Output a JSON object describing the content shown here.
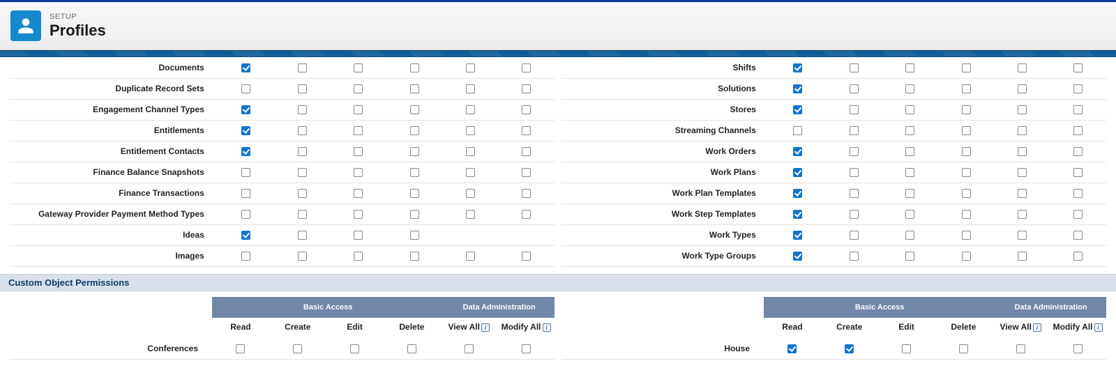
{
  "header": {
    "setup": "SETUP",
    "title": "Profiles"
  },
  "left_rows": [
    {
      "label": "Documents",
      "cells": [
        true,
        false,
        false,
        false,
        false,
        false
      ]
    },
    {
      "label": "Duplicate Record Sets",
      "cells": [
        false,
        false,
        false,
        false,
        false,
        false
      ]
    },
    {
      "label": "Engagement Channel Types",
      "cells": [
        true,
        false,
        false,
        false,
        false,
        false
      ]
    },
    {
      "label": "Entitlements",
      "cells": [
        true,
        false,
        false,
        false,
        false,
        false
      ]
    },
    {
      "label": "Entitlement Contacts",
      "cells": [
        true,
        false,
        false,
        false,
        false,
        false
      ]
    },
    {
      "label": "Finance Balance Snapshots",
      "cells": [
        false,
        false,
        false,
        false,
        false,
        false
      ]
    },
    {
      "label": "Finance Transactions",
      "cells": [
        false,
        false,
        false,
        false,
        false,
        false
      ]
    },
    {
      "label": "Gateway Provider Payment Method Types",
      "cells": [
        false,
        false,
        false,
        false,
        false,
        false
      ]
    },
    {
      "label": "Ideas",
      "cells": [
        true,
        false,
        false,
        false,
        null,
        null
      ]
    },
    {
      "label": "Images",
      "cells": [
        false,
        false,
        false,
        false,
        false,
        false
      ]
    }
  ],
  "right_rows": [
    {
      "label": "Shifts",
      "cells": [
        true,
        false,
        false,
        false,
        false,
        false
      ]
    },
    {
      "label": "Solutions",
      "cells": [
        true,
        false,
        false,
        false,
        false,
        false
      ]
    },
    {
      "label": "Stores",
      "cells": [
        true,
        false,
        false,
        false,
        false,
        false
      ]
    },
    {
      "label": "Streaming Channels",
      "cells": [
        false,
        false,
        false,
        false,
        false,
        false
      ]
    },
    {
      "label": "Work Orders",
      "cells": [
        true,
        false,
        false,
        false,
        false,
        false
      ]
    },
    {
      "label": "Work Plans",
      "cells": [
        true,
        false,
        false,
        false,
        false,
        false
      ]
    },
    {
      "label": "Work Plan Templates",
      "cells": [
        true,
        false,
        false,
        false,
        false,
        false
      ]
    },
    {
      "label": "Work Step Templates",
      "cells": [
        true,
        false,
        false,
        false,
        false,
        false
      ]
    },
    {
      "label": "Work Types",
      "cells": [
        true,
        false,
        false,
        false,
        false,
        false
      ]
    },
    {
      "label": "Work Type Groups",
      "cells": [
        true,
        false,
        false,
        false,
        false,
        false
      ]
    }
  ],
  "section_custom_title": "Custom Object Permissions",
  "group_headers": {
    "basic_access": "Basic Access",
    "data_admin": "Data Administration"
  },
  "columns": {
    "read": "Read",
    "create": "Create",
    "edit": "Edit",
    "delete": "Delete",
    "view_all": "View All",
    "modify_all": "Modify All"
  },
  "custom_left_rows": [
    {
      "label": "Conferences",
      "cells": [
        false,
        false,
        false,
        false,
        false,
        false
      ]
    }
  ],
  "custom_right_rows": [
    {
      "label": "House",
      "cells": [
        true,
        true,
        false,
        false,
        false,
        false
      ]
    }
  ]
}
